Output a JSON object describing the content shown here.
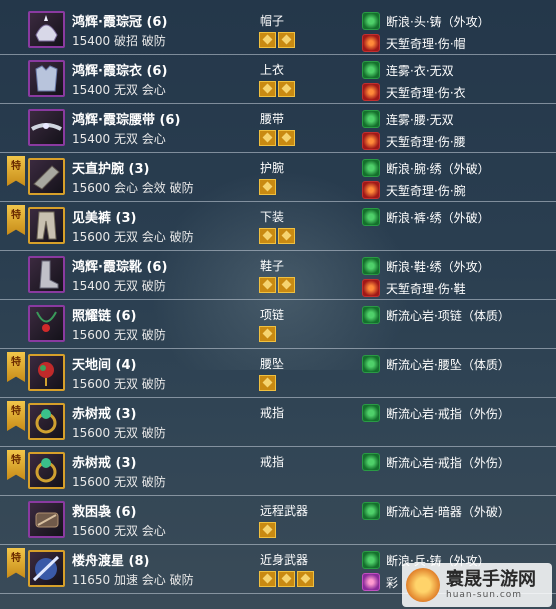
{
  "items": [
    {
      "name": "鸿辉·霞琮冠 (6)",
      "stats": "15400 破招 破防",
      "slot": "帽子",
      "special": false,
      "gems": 2,
      "icon": "helmet-icon",
      "effects": [
        {
          "type": "green",
          "text": "断浪·头·铸（外攻）"
        },
        {
          "type": "red",
          "text": "天堑奇理·伤·帽"
        }
      ]
    },
    {
      "name": "鸿辉·霞琮衣 (6)",
      "stats": "15400 无双 会心",
      "slot": "上衣",
      "special": false,
      "gems": 2,
      "icon": "armor-icon",
      "effects": [
        {
          "type": "green",
          "text": "连雾·衣·无双"
        },
        {
          "type": "red",
          "text": "天堑奇理·伤·衣"
        }
      ]
    },
    {
      "name": "鸿辉·霞琮腰带 (6)",
      "stats": "15400 无双 会心",
      "slot": "腰带",
      "special": false,
      "gems": 2,
      "icon": "belt-icon",
      "effects": [
        {
          "type": "green",
          "text": "连雾·腰·无双"
        },
        {
          "type": "red",
          "text": "天堑奇理·伤·腰"
        }
      ]
    },
    {
      "name": "天直护腕 (3)",
      "stats": "15600 会心 会效 破防",
      "slot": "护腕",
      "special": true,
      "gems": 1,
      "icon": "bracer-icon",
      "effects": [
        {
          "type": "green",
          "text": "断浪·腕·绣（外破）"
        },
        {
          "type": "red",
          "text": "天堑奇理·伤·腕"
        }
      ]
    },
    {
      "name": "见美裤 (3)",
      "stats": "15600 无双 会心 破防",
      "slot": "下装",
      "special": true,
      "gems": 2,
      "icon": "pants-icon",
      "effects": [
        {
          "type": "green",
          "text": "断浪·裤·绣（外破）"
        }
      ]
    },
    {
      "name": "鸿辉·霞琮靴 (6)",
      "stats": "15400 无双 破防",
      "slot": "鞋子",
      "special": false,
      "gems": 2,
      "icon": "boots-icon",
      "effects": [
        {
          "type": "green",
          "text": "断浪·鞋·绣（外攻）"
        },
        {
          "type": "red",
          "text": "天堑奇理·伤·鞋"
        }
      ]
    },
    {
      "name": "照耀链 (6)",
      "stats": "15600 无双 破防",
      "slot": "项链",
      "special": false,
      "gems": 1,
      "icon": "necklace-icon",
      "effects": [
        {
          "type": "green",
          "text": "断流心岩·项链（体质）"
        }
      ]
    },
    {
      "name": "天地间 (4)",
      "stats": "15600 无双 破防",
      "slot": "腰坠",
      "special": true,
      "gems": 1,
      "icon": "pendant-icon",
      "effects": [
        {
          "type": "green",
          "text": "断流心岩·腰坠（体质）"
        }
      ]
    },
    {
      "name": "赤树戒 (3)",
      "stats": "15600 无双 破防",
      "slot": "戒指",
      "special": true,
      "gems": 0,
      "icon": "ring-icon",
      "effects": [
        {
          "type": "green",
          "text": "断流心岩·戒指（外伤）"
        }
      ]
    },
    {
      "name": "赤树戒 (3)",
      "stats": "15600 无双 破防",
      "slot": "戒指",
      "special": true,
      "gems": 0,
      "icon": "ring-icon",
      "effects": [
        {
          "type": "green",
          "text": "断流心岩·戒指（外伤）"
        }
      ]
    },
    {
      "name": "救困袅 (6)",
      "stats": "15600 无双 会心",
      "slot": "远程武器",
      "special": false,
      "gems": 1,
      "icon": "ranged-weapon-icon",
      "effects": [
        {
          "type": "green",
          "text": "断流心岩·暗器（外破）"
        }
      ]
    },
    {
      "name": "楼舟渡星 (8)",
      "stats": "11650 加速 会心 破防",
      "slot": "近身武器",
      "special": true,
      "gems": 3,
      "icon": "melee-weapon-icon",
      "effects": [
        {
          "type": "green",
          "text": "断浪·兵·铸（外攻）"
        },
        {
          "type": "pink",
          "text": "彩"
        }
      ]
    }
  ],
  "special_tag": "特",
  "watermark": {
    "title": "寰晟手游网",
    "url": "huan-sun.com"
  },
  "colors": {
    "gem_gold": "#c98a12",
    "frame_purple": "#8a3aa0",
    "frame_gold": "#d7a02a",
    "effect_green": "#2a9a45",
    "effect_red": "#c03030"
  }
}
